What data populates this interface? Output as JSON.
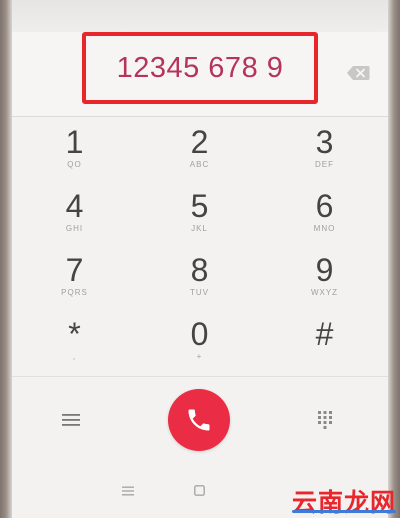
{
  "display": {
    "number": "12345 678 9"
  },
  "keypad": {
    "keys": [
      {
        "digit": "1",
        "letters": "QO"
      },
      {
        "digit": "2",
        "letters": "ABC"
      },
      {
        "digit": "3",
        "letters": "DEF"
      },
      {
        "digit": "4",
        "letters": "GHI"
      },
      {
        "digit": "5",
        "letters": "JKL"
      },
      {
        "digit": "6",
        "letters": "MNO"
      },
      {
        "digit": "7",
        "letters": "PQRS"
      },
      {
        "digit": "8",
        "letters": "TUV"
      },
      {
        "digit": "9",
        "letters": "WXYZ"
      },
      {
        "digit": "*",
        "letters": ","
      },
      {
        "digit": "0",
        "letters": "+"
      },
      {
        "digit": "#",
        "letters": ""
      }
    ]
  },
  "icons": {
    "backspace": "backspace-icon",
    "menu": "menu-icon",
    "call": "phone-icon",
    "dialpad": "dialpad-icon",
    "nav_menu": "nav-menu-icon",
    "nav_home": "nav-home-icon"
  },
  "colors": {
    "accent": "#e8262b",
    "call_button": "#ea2c45",
    "number_text": "#b5345a"
  },
  "watermark": {
    "text": "云南龙网"
  }
}
